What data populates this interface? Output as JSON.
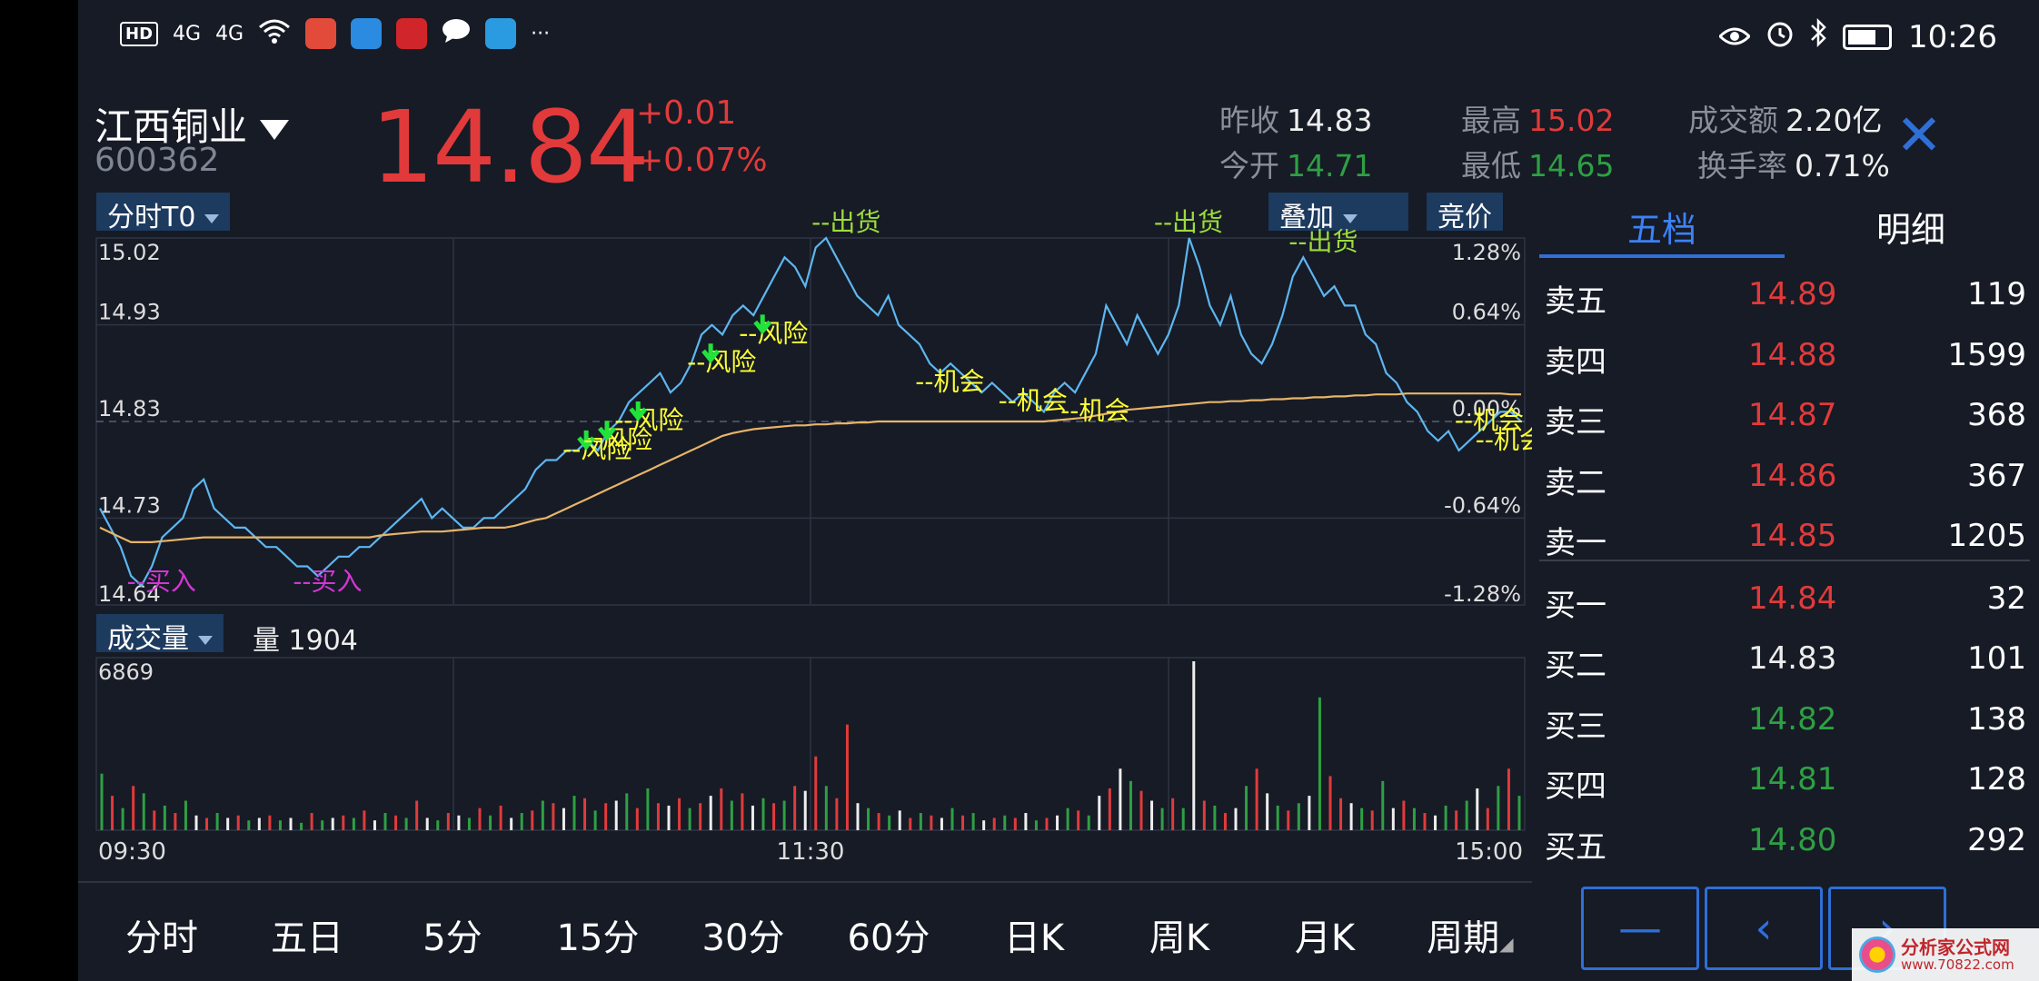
{
  "status_bar": {
    "left_badge": "HD",
    "signal1": "4G",
    "signal2": "4G",
    "more": "···",
    "time": "10:26"
  },
  "header": {
    "stock_name": "江西铜业",
    "stock_code": "600362",
    "price": "14.84",
    "change": "+0.01",
    "change_pct": "+0.07%",
    "prev_close_label": "昨收",
    "prev_close": "14.83",
    "open_label": "今开",
    "open": "14.71",
    "high_label": "最高",
    "high": "15.02",
    "low_label": "最低",
    "low": "14.65",
    "turnover_label": "成交额",
    "turnover": "2.20亿",
    "turnover_rate_label": "换手率",
    "turnover_rate": "0.71%",
    "close_glyph": "✕"
  },
  "toolbar": {
    "mode_label": "分时T0",
    "overlay_label": "叠加",
    "auction_label": "竞价",
    "volume_label": "成交量",
    "volume_value_label": "量 1904"
  },
  "chart_data": [
    {
      "type": "line",
      "name": "intraday-price",
      "price_axis": [
        "15.02",
        "14.93",
        "14.83",
        "14.73",
        "14.64"
      ],
      "pct_axis": [
        "1.28%",
        "0.64%",
        "0.00%",
        "-0.64%",
        "-1.28%"
      ],
      "ylim": [
        14.64,
        15.02
      ],
      "x_labels": [
        "09:30",
        "11:30",
        "15:00"
      ],
      "series": [
        {
          "values": [
            14.74,
            14.72,
            14.7,
            14.67,
            14.66,
            14.68,
            14.71,
            14.72,
            14.73,
            14.76,
            14.77,
            14.74,
            14.73,
            14.72,
            14.72,
            14.71,
            14.7,
            14.7,
            14.69,
            14.68,
            14.68,
            14.67,
            14.68,
            14.69,
            14.69,
            14.7,
            14.7,
            14.71,
            14.72,
            14.73,
            14.74,
            14.75,
            14.73,
            14.74,
            14.73,
            14.72,
            14.72,
            14.73,
            14.73,
            14.74,
            14.75,
            14.76,
            14.78,
            14.79,
            14.79,
            14.8,
            14.8,
            14.81,
            14.8,
            14.82,
            14.83,
            14.85,
            14.86,
            14.87,
            14.88,
            14.86,
            14.87,
            14.89,
            14.92,
            14.93,
            14.92,
            14.94,
            14.95,
            14.94,
            14.96,
            14.98,
            15.0,
            14.99,
            14.97,
            15.01,
            15.02,
            15.0,
            14.98,
            14.96,
            14.95,
            14.94,
            14.96,
            14.93,
            14.92,
            14.91,
            14.89,
            14.88,
            14.89,
            14.88,
            14.87,
            14.86,
            14.87,
            14.86,
            14.85,
            14.86,
            14.85,
            14.84,
            14.86,
            14.87,
            14.86,
            14.88,
            14.9,
            14.95,
            14.93,
            14.91,
            14.94,
            14.92,
            14.9,
            14.92,
            14.95,
            15.02,
            14.99,
            14.95,
            14.93,
            14.96,
            14.92,
            14.9,
            14.89,
            14.91,
            14.94,
            14.98,
            15.0,
            14.98,
            14.96,
            14.97,
            14.95,
            14.95,
            14.92,
            14.91,
            14.88,
            14.87,
            14.85,
            14.84,
            14.82,
            14.81,
            14.82,
            14.8,
            14.81,
            14.82,
            14.83,
            14.84,
            14.84,
            14.83
          ]
        },
        {
          "values": [
            14.72,
            14.715,
            14.71,
            14.705,
            14.705,
            14.705,
            14.706,
            14.707,
            14.708,
            14.709,
            14.71,
            14.71,
            14.71,
            14.71,
            14.71,
            14.71,
            14.71,
            14.71,
            14.71,
            14.71,
            14.71,
            14.71,
            14.71,
            14.71,
            14.71,
            14.71,
            14.71,
            14.712,
            14.713,
            14.714,
            14.715,
            14.716,
            14.716,
            14.716,
            14.717,
            14.718,
            14.719,
            14.72,
            14.72,
            14.72,
            14.722,
            14.725,
            14.728,
            14.73,
            14.735,
            14.74,
            14.745,
            14.75,
            14.755,
            14.76,
            14.765,
            14.77,
            14.775,
            14.78,
            14.785,
            14.79,
            14.795,
            14.8,
            14.805,
            14.81,
            14.815,
            14.818,
            14.82,
            14.822,
            14.823,
            14.824,
            14.825,
            14.826,
            14.826,
            14.827,
            14.827,
            14.828,
            14.828,
            14.829,
            14.829,
            14.83,
            14.83,
            14.83,
            14.83,
            14.83,
            14.83,
            14.83,
            14.83,
            14.83,
            14.83,
            14.83,
            14.83,
            14.83,
            14.83,
            14.83,
            14.83,
            14.83,
            14.831,
            14.832,
            14.833,
            14.834,
            14.836,
            14.838,
            14.84,
            14.842,
            14.843,
            14.844,
            14.845,
            14.846,
            14.847,
            14.848,
            14.849,
            14.85,
            14.85,
            14.851,
            14.851,
            14.852,
            14.852,
            14.853,
            14.853,
            14.854,
            14.854,
            14.855,
            14.855,
            14.856,
            14.856,
            14.857,
            14.857,
            14.858,
            14.858,
            14.858,
            14.859,
            14.859,
            14.859,
            14.859,
            14.859,
            14.859,
            14.859,
            14.859,
            14.859,
            14.859,
            14.858,
            14.858
          ]
        }
      ],
      "annotations": [
        {
          "text": "--买入",
          "color": "#d236d2",
          "i": 4,
          "price": 14.68
        },
        {
          "text": "--买入",
          "color": "#d236d2",
          "i": 20,
          "price": 14.68
        },
        {
          "text": "--风险",
          "color": "#ffff33",
          "i": 46,
          "price": 14.8
        },
        {
          "text": "--风险",
          "color": "#ffff33",
          "i": 48,
          "price": 14.81
        },
        {
          "text": "--风险",
          "color": "#ffff33",
          "i": 51,
          "price": 14.83
        },
        {
          "text": "--风险",
          "color": "#ffff33",
          "i": 58,
          "price": 14.89
        },
        {
          "text": "--风险",
          "color": "#ffff33",
          "i": 63,
          "price": 14.92
        },
        {
          "text": "--出货",
          "color": "#9ddc3a",
          "i": 70,
          "price": 15.02
        },
        {
          "text": "--机会",
          "color": "#ffff33",
          "i": 80,
          "price": 14.87
        },
        {
          "text": "--机会",
          "color": "#ffff33",
          "i": 88,
          "price": 14.85
        },
        {
          "text": "--机会",
          "color": "#ffff33",
          "i": 94,
          "price": 14.84
        },
        {
          "text": "--出货",
          "color": "#9ddc3a",
          "i": 103,
          "price": 15.02
        },
        {
          "text": "--出货",
          "color": "#9ddc3a",
          "i": 116,
          "price": 15.0
        },
        {
          "text": "--机会",
          "color": "#ffff33",
          "i": 132,
          "price": 14.83
        },
        {
          "text": "--机会",
          "color": "#ffff33",
          "i": 134,
          "price": 14.81
        }
      ]
    },
    {
      "type": "bar",
      "name": "volume",
      "y_max_label": "6869",
      "ylim": [
        0,
        6869
      ],
      "values": [
        2300,
        1400,
        900,
        1800,
        1500,
        800,
        1000,
        700,
        1200,
        600,
        500,
        700,
        500,
        600,
        400,
        500,
        600,
        400,
        500,
        300,
        700,
        400,
        500,
        600,
        500,
        800,
        400,
        700,
        600,
        500,
        1200,
        500,
        400,
        700,
        600,
        500,
        900,
        600,
        1000,
        500,
        700,
        800,
        1200,
        1100,
        900,
        1400,
        1300,
        800,
        1100,
        1200,
        1500,
        900,
        1700,
        1100,
        1000,
        1300,
        900,
        1100,
        1400,
        1700,
        1200,
        1500,
        1000,
        1300,
        1100,
        1200,
        1800,
        1600,
        3000,
        1800,
        1300,
        4300,
        1100,
        900,
        700,
        600,
        800,
        500,
        700,
        600,
        500,
        900,
        600,
        700,
        400,
        500,
        600,
        500,
        700,
        400,
        500,
        600,
        900,
        800,
        600,
        1400,
        1700,
        2500,
        2000,
        1600,
        1200,
        900,
        1300,
        900,
        6869,
        1200,
        1000,
        700,
        900,
        1800,
        2500,
        1500,
        1000,
        800,
        1100,
        1400,
        5400,
        2200,
        1300,
        1100,
        900,
        800,
        2000,
        900,
        1200,
        900,
        700,
        600,
        1000,
        800,
        1200,
        1700,
        900,
        1800,
        2500,
        1400
      ],
      "colors": [
        "g",
        "r",
        "g",
        "r",
        "g",
        "r",
        "g",
        "r",
        "g",
        "w",
        "r",
        "g",
        "w",
        "r",
        "g",
        "w",
        "r",
        "g",
        "w",
        "g",
        "r",
        "g",
        "w",
        "r",
        "g",
        "r",
        "w",
        "g",
        "r",
        "g",
        "r",
        "w",
        "g",
        "r",
        "w",
        "g",
        "r",
        "g",
        "r",
        "w",
        "g",
        "r",
        "g",
        "r",
        "w",
        "g",
        "r",
        "g",
        "r",
        "w",
        "g",
        "r",
        "g",
        "r",
        "w",
        "r",
        "g",
        "r",
        "w",
        "r",
        "g",
        "r",
        "w",
        "g",
        "r",
        "g",
        "r",
        "w",
        "r",
        "g",
        "r",
        "r",
        "w",
        "g",
        "r",
        "g",
        "w",
        "r",
        "g",
        "r",
        "w",
        "g",
        "r",
        "g",
        "w",
        "r",
        "g",
        "r",
        "w",
        "g",
        "r",
        "w",
        "g",
        "r",
        "g",
        "w",
        "r",
        "w",
        "g",
        "r",
        "w",
        "g",
        "r",
        "g",
        "w",
        "r",
        "g",
        "r",
        "w",
        "g",
        "r",
        "w",
        "g",
        "r",
        "g",
        "w",
        "g",
        "r",
        "r",
        "w",
        "g",
        "r",
        "g",
        "w",
        "r",
        "g",
        "r",
        "w",
        "g",
        "r",
        "g",
        "w",
        "r",
        "g",
        "r",
        "g",
        "r",
        "g",
        "r",
        "g"
      ]
    }
  ],
  "order_book": {
    "tab_active": "五档",
    "tab_other": "明细",
    "asks": [
      {
        "label": "卖五",
        "price": "14.89",
        "qty": "119",
        "color": "#e23a3a"
      },
      {
        "label": "卖四",
        "price": "14.88",
        "qty": "1599",
        "color": "#e23a3a"
      },
      {
        "label": "卖三",
        "price": "14.87",
        "qty": "368",
        "color": "#e23a3a"
      },
      {
        "label": "卖二",
        "price": "14.86",
        "qty": "367",
        "color": "#e23a3a"
      },
      {
        "label": "卖一",
        "price": "14.85",
        "qty": "1205",
        "color": "#e23a3a"
      }
    ],
    "bids": [
      {
        "label": "买一",
        "price": "14.84",
        "qty": "32",
        "color": "#e23a3a"
      },
      {
        "label": "买二",
        "price": "14.83",
        "qty": "101",
        "color": "#eeeeee"
      },
      {
        "label": "买三",
        "price": "14.82",
        "qty": "138",
        "color": "#2ea043"
      },
      {
        "label": "买四",
        "price": "14.81",
        "qty": "128",
        "color": "#2ea043"
      },
      {
        "label": "买五",
        "price": "14.80",
        "qty": "292",
        "color": "#2ea043"
      }
    ]
  },
  "bottom_tabs": [
    "分时",
    "五日",
    "5分",
    "15分",
    "30分",
    "60分",
    "日K",
    "周K",
    "月K",
    "周期"
  ],
  "nav_buttons": [
    "—",
    "‹",
    "›"
  ],
  "watermark": {
    "line1": "分析家公式网",
    "line2": "www.70822.com"
  },
  "colors": {
    "up": "#e23a3a",
    "down": "#2ea043",
    "accent": "#2f6fd6",
    "price_line": "#5eb6f0",
    "avg_line": "#e8b468"
  }
}
